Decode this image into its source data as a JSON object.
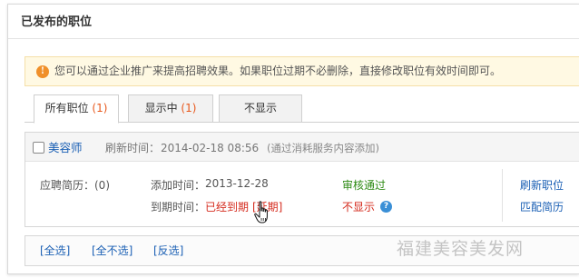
{
  "panel": {
    "title": "已发布的职位"
  },
  "notice": {
    "icon": "exclamation-icon",
    "text": "您可以通过企业推广来提高招聘效果。如果职位过期不必删除，直接修改职位有效时间即可。"
  },
  "tabs": [
    {
      "label": "所有职位",
      "count": "(1)",
      "active": true
    },
    {
      "label": "显示中",
      "count": "(1)",
      "active": false
    },
    {
      "label": "不显示",
      "count": "",
      "active": false
    }
  ],
  "job": {
    "name": "美容师",
    "refresh_label": "刷新时间：",
    "refresh_time": "2014-02-18 08:56",
    "refresh_note": "(通过消耗服务内容添加)",
    "resume_label": "应聘简历：(0)",
    "added_label": "添加时间：",
    "added_date": "2013-12-28",
    "audit_status": "审核通过",
    "expire_label": "到期时间：",
    "expire_value": "已经到期",
    "extend_link": "[延期]",
    "display_status": "不显示",
    "actions": {
      "refresh": "刷新职位",
      "match": "匹配简历"
    }
  },
  "footer": {
    "select_all": "[全选]",
    "select_none": "[全不选]",
    "invert": "[反选]"
  },
  "watermark": "福建美容美发网",
  "colors": {
    "link": "#1a5fb4",
    "accent": "#e8581c",
    "ok": "#2e8b14",
    "alert": "#d52b1e"
  }
}
